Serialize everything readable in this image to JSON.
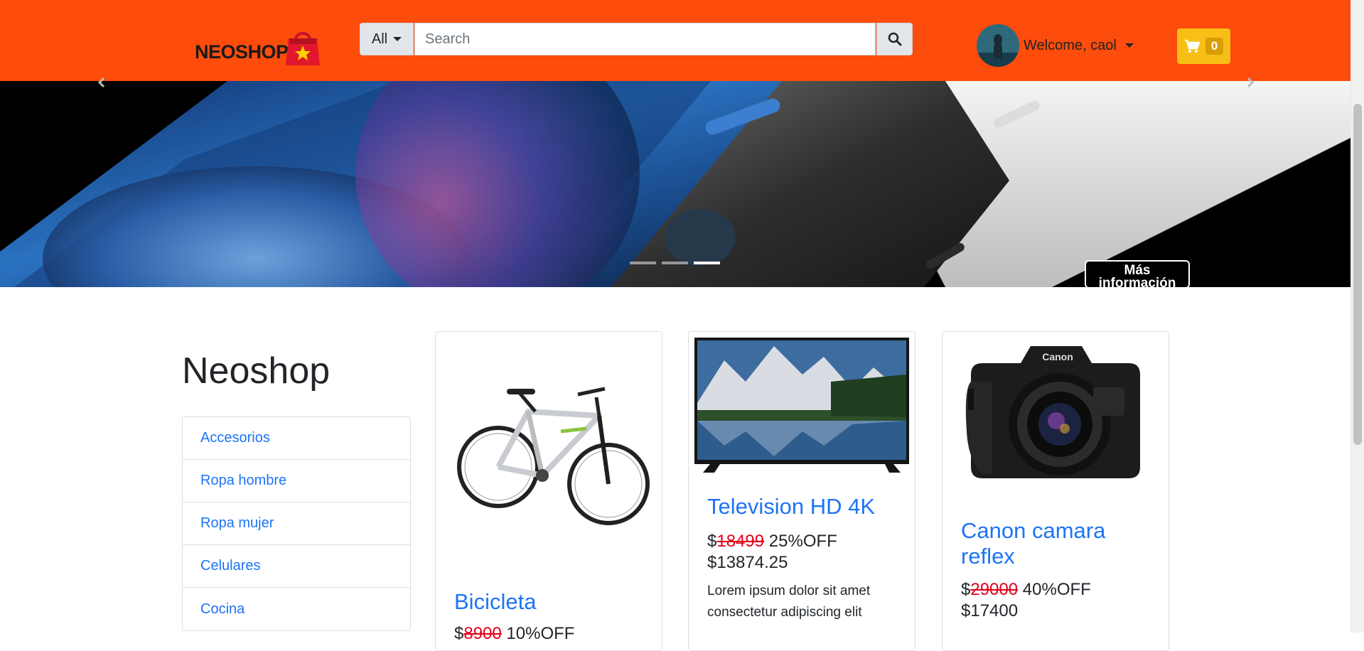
{
  "header": {
    "logo_text": "NEOSHOP",
    "search": {
      "category_label": "All",
      "placeholder": "Search"
    },
    "user": {
      "welcome_text": "Welcome, caol"
    },
    "cart": {
      "count": "0"
    },
    "brand_color": "#fd4c0b",
    "cart_color": "#f8bf17"
  },
  "hero": {
    "more_info_label": "Más información",
    "slides_count": 3,
    "active_slide": 3
  },
  "main": {
    "title": "Neoshop",
    "categories": [
      {
        "label": "Accesorios"
      },
      {
        "label": "Ropa hombre"
      },
      {
        "label": "Ropa mujer"
      },
      {
        "label": "Celulares"
      },
      {
        "label": "Cocina"
      }
    ],
    "products": [
      {
        "name": "Bicicleta",
        "currency": "$",
        "old_price": "8900",
        "discount": "10%OFF",
        "image": "bicycle"
      },
      {
        "name": "Television HD 4K",
        "currency": "$",
        "old_price": "18499",
        "discount": "25%OFF",
        "new_price": "$13874.25",
        "description": "Lorem ipsum dolor sit amet consectetur adipiscing elit",
        "image": "television"
      },
      {
        "name": "Canon camara reflex",
        "currency": "$",
        "old_price": "29000",
        "discount": "40%OFF",
        "new_price": "$17400",
        "image": "camera"
      }
    ]
  }
}
